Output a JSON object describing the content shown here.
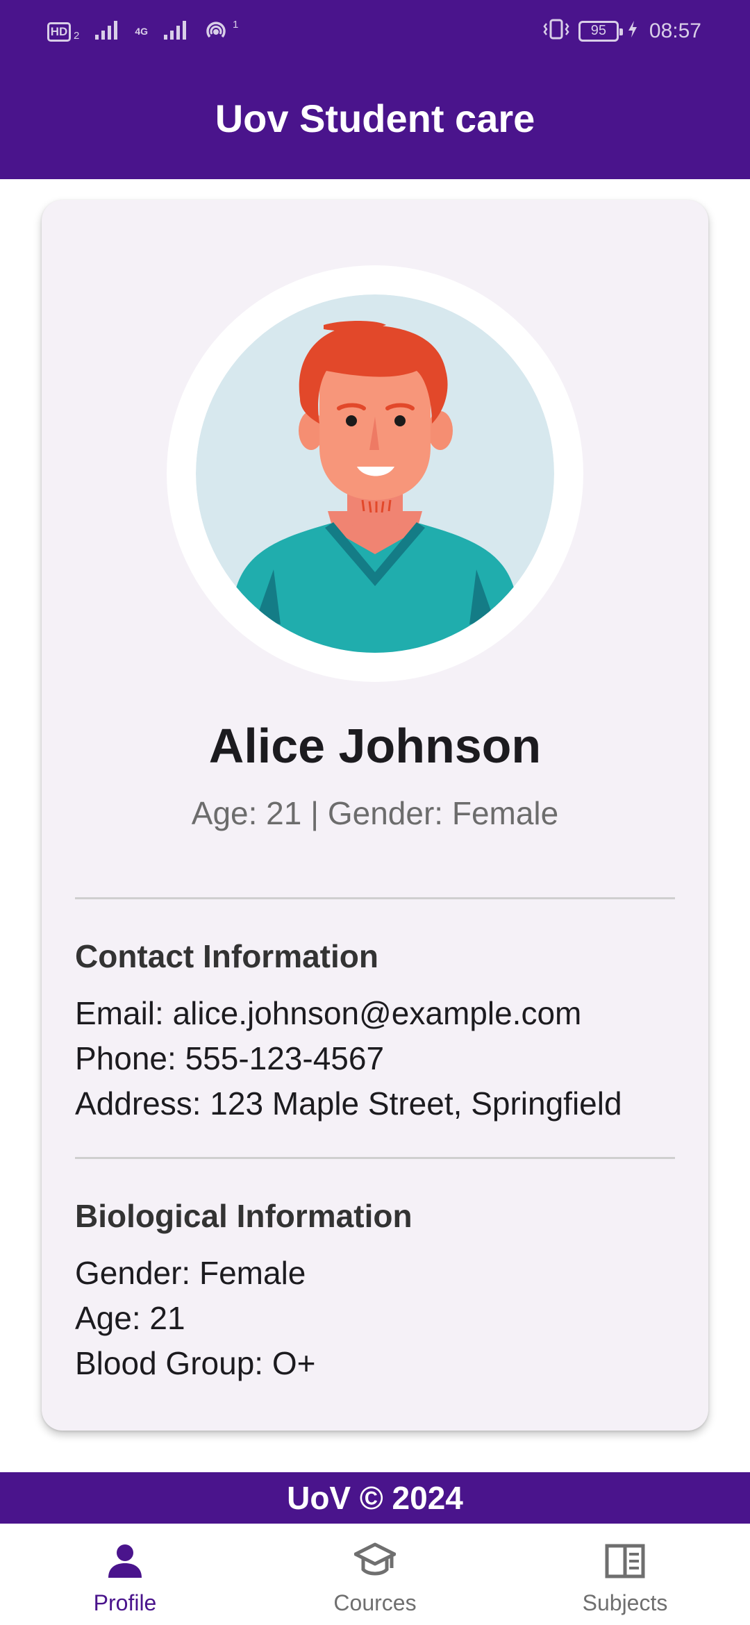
{
  "status_bar": {
    "hd_label": "HD",
    "sim_number": "2",
    "network_label": "4G",
    "hotspot_count": "1",
    "battery_level": "95",
    "time": "08:57"
  },
  "app_bar": {
    "title": "Uov Student care"
  },
  "profile": {
    "name": "Alice Johnson",
    "summary": "Age: 21 | Gender: Female",
    "contact": {
      "heading": "Contact Information",
      "email": "Email: alice.johnson@example.com",
      "phone": "Phone: 555-123-4567",
      "address": "Address: 123 Maple Street, Springfield"
    },
    "biological": {
      "heading": "Biological Information",
      "gender": "Gender: Female",
      "age": "Age: 21",
      "blood_group": "Blood Group: O+"
    }
  },
  "footer": {
    "text": "UoV © 2024"
  },
  "bottom_nav": {
    "items": [
      {
        "label": "Profile",
        "icon": "person-icon",
        "active": true
      },
      {
        "label": "Cources",
        "icon": "graduation-cap-icon",
        "active": false
      },
      {
        "label": "Subjects",
        "icon": "book-icon",
        "active": false
      }
    ]
  },
  "colors": {
    "primary": "#4a148c",
    "card_background": "#f5f1f7",
    "inactive_nav": "#6f6f6f"
  }
}
